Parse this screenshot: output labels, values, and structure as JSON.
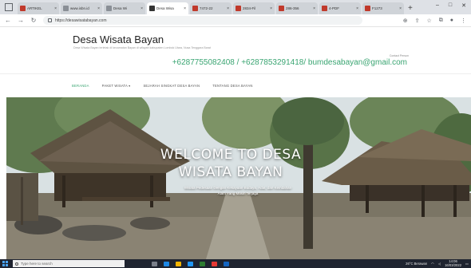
{
  "browser": {
    "tabs": [
      {
        "title": "ARTIKEL",
        "icon": "red",
        "active": false
      },
      {
        "title": "www.isbn.id",
        "icon": "grey",
        "active": false
      },
      {
        "title": "Desa Wi",
        "icon": "grey",
        "active": false
      },
      {
        "title": "Desa Wisa",
        "icon": "dark",
        "active": true
      },
      {
        "title": "7472-22",
        "icon": "red",
        "active": false
      },
      {
        "title": "2834-Fil",
        "icon": "red",
        "active": false
      },
      {
        "title": "286-356",
        "icon": "red",
        "active": false
      },
      {
        "title": "4-PDF",
        "icon": "red",
        "active": false
      },
      {
        "title": "F1273",
        "icon": "red",
        "active": false
      }
    ],
    "url": "https://desawisatabayan.com",
    "new_tab_symbol": "+",
    "window_controls": [
      "–",
      "□",
      "✕"
    ]
  },
  "site": {
    "title": "Desa Wisata Bayan",
    "tagline": "Desa Wisata Bayan terletak di kecamatan Bayan di wilayah kabupaten Lombok Utara, Nusa Tenggara Barat",
    "contact_label": "Contact Person",
    "contact_line": "+6287755082408 / +6287853291418/ bumdesabayan@gmail.com"
  },
  "menu": [
    {
      "label": "BERANDA",
      "active": true
    },
    {
      "label": "PAKET WISATA ▾",
      "active": false
    },
    {
      "label": "SEJARAH SINGKAT DESA BAYAN",
      "active": false
    },
    {
      "label": "TENTANG DESA BAYAN",
      "active": false
    }
  ],
  "hero": {
    "title_line1": "WELCOME TO DESA",
    "title_line2": "WISATA BAYAN",
    "sub_line1": "Wisata Pedesaan Dengan Kekayaan Budaya, Adat, dan Keindahan",
    "sub_line2": "Alam Yang Masih Terjaga"
  },
  "taskbar": {
    "search_placeholder": "Type here to search",
    "weather": "26°C Berawan",
    "time": "14:06",
    "date": "16/03/2022"
  },
  "colors": {
    "accent_green": "#3aa572",
    "taskbar": "#1f2430"
  }
}
